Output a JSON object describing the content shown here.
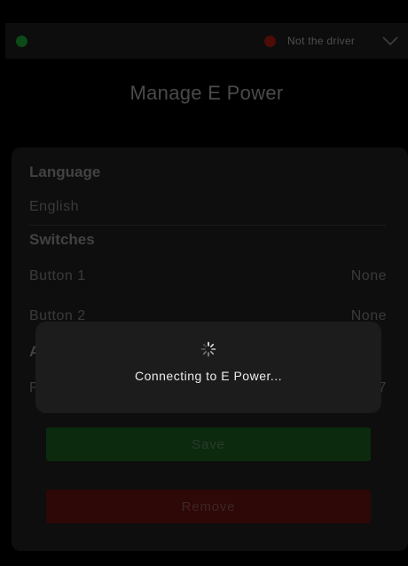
{
  "status": {
    "driver_label": "Not the driver",
    "left_indicator_color": "#0c4a17",
    "right_indicator_color": "#4d0c07"
  },
  "page": {
    "title": "Manage E Power"
  },
  "settings": {
    "language_heading": "Language",
    "language_value": "English",
    "switches_heading": "Switches",
    "button1_label": "Button 1",
    "button1_value": "None",
    "button2_label": "Button 2",
    "button2_value": "None",
    "partial_heading": "A",
    "partial_row_label": "F",
    "partial_row_value": "7"
  },
  "actions": {
    "save_label": "Save",
    "remove_label": "Remove"
  },
  "loading": {
    "message": "Connecting to E Power...",
    "spinner_icon": "spinner-icon"
  }
}
